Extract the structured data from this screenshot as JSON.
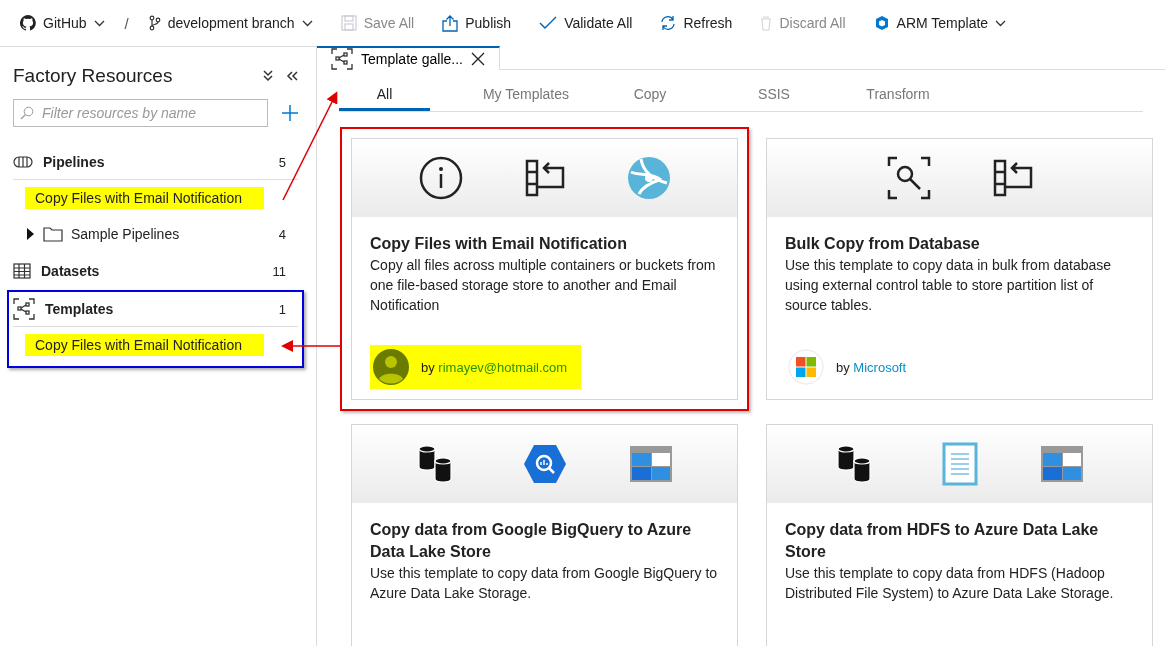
{
  "toolbar": {
    "items": [
      {
        "kind": "github",
        "label": "GitHub",
        "caret": true,
        "disabled": false
      },
      {
        "kind": "separator",
        "label": "/"
      },
      {
        "kind": "branch",
        "label": "development branch",
        "caret": true,
        "disabled": false
      },
      {
        "kind": "save",
        "label": "Save All",
        "caret": false,
        "disabled": true
      },
      {
        "kind": "publish",
        "label": "Publish",
        "caret": false,
        "disabled": false
      },
      {
        "kind": "validate",
        "label": "Validate All",
        "caret": false,
        "disabled": false
      },
      {
        "kind": "refresh",
        "label": "Refresh",
        "caret": false,
        "disabled": false
      },
      {
        "kind": "discard",
        "label": "Discard All",
        "caret": false,
        "disabled": true
      },
      {
        "kind": "arm",
        "label": "ARM Template",
        "caret": true,
        "disabled": false
      }
    ]
  },
  "sidebar": {
    "title": "Factory Resources",
    "filter": {
      "placeholder": "Filter resources by name"
    },
    "sections": [
      {
        "kind": "pipelines",
        "label": "Pipelines",
        "count": "5",
        "boxed": false,
        "children": [
          {
            "kind": "item",
            "label": "Copy Files with Email Notification",
            "highlighted": true
          },
          {
            "kind": "folder",
            "label": "Sample Pipelines",
            "count": "4",
            "expanded": false
          }
        ]
      },
      {
        "kind": "datasets",
        "label": "Datasets",
        "count": "11",
        "boxed": false
      },
      {
        "kind": "templates",
        "label": "Templates",
        "count": "1",
        "boxed": true,
        "children": [
          {
            "kind": "item",
            "label": "Copy Files with Email Notification",
            "highlighted": true
          }
        ]
      }
    ]
  },
  "document_tab": {
    "title": "Template galle...",
    "selected": true
  },
  "gallery_tabs": [
    {
      "label": "All",
      "selected": true
    },
    {
      "label": "My Templates",
      "selected": false
    },
    {
      "label": "Copy",
      "selected": false
    },
    {
      "label": "SSIS",
      "selected": false
    },
    {
      "label": "Transform",
      "selected": false
    }
  ],
  "templates": [
    {
      "title": "Copy Files with Email Notification",
      "description": "Copy all files across multiple containers or buckets from one file-based storage store to another and Email Notification",
      "icons": [
        {
          "kind": "info"
        },
        {
          "kind": "copy-table"
        },
        {
          "kind": "globe"
        }
      ],
      "author": {
        "kind": "person",
        "by_label": "by",
        "name": "rimayev@hotmail.com",
        "highlighted": true
      },
      "outlined": true
    },
    {
      "title": "Bulk Copy from Database",
      "description": "Use this template to copy data in bulk from database using external control table to store partition list of source tables.",
      "icons": [
        {
          "kind": "search-frame"
        },
        {
          "kind": "copy-table"
        }
      ],
      "author": {
        "kind": "microsoft",
        "by_label": "by",
        "name": "Microsoft",
        "highlighted": false
      },
      "outlined": false
    },
    {
      "title": "Copy data from Google BigQuery to Azure Data Lake Store",
      "description": "Use this template to copy data from Google BigQuery to Azure Data Lake Storage.",
      "icons": [
        {
          "kind": "database"
        },
        {
          "kind": "bigquery"
        },
        {
          "kind": "datalake"
        }
      ],
      "outlined": false
    },
    {
      "title": "Copy data from HDFS to Azure Data Lake Store",
      "description": "Use this template to copy data from HDFS (Hadoop Distributed File System) to Azure Data Lake Storage.",
      "icons": [
        {
          "kind": "database"
        },
        {
          "kind": "document"
        },
        {
          "kind": "datalake"
        }
      ],
      "outlined": false
    }
  ]
}
